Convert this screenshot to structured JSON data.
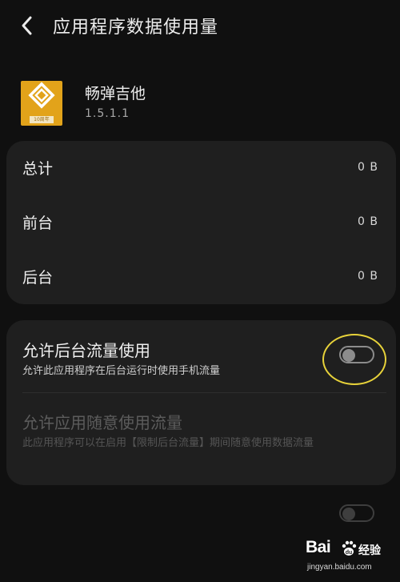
{
  "header": {
    "title": "应用程序数据使用量",
    "back_icon": "chevron-left-icon"
  },
  "app": {
    "name": "畅弹吉他",
    "version": "1.5.1.1",
    "icon": "app-logo-icon",
    "icon_badge": "10周年",
    "icon_color": "#e2a31a"
  },
  "usage": {
    "rows": [
      {
        "label": "总计",
        "value": "0 B"
      },
      {
        "label": "前台",
        "value": "0 B"
      },
      {
        "label": "后台",
        "value": "0 B"
      }
    ]
  },
  "permissions": {
    "background_data": {
      "title": "允许后台流量使用",
      "description": "允许此应用程序在后台运行时使用手机流量",
      "enabled": false
    },
    "unrestricted_data": {
      "title": "允许应用随意使用流量",
      "description": "此应用程序可以在启用【限制后台流量】期间随意使用数据流量",
      "enabled": false,
      "disabled": true
    }
  },
  "watermark": {
    "brand": "Bai",
    "brand_suffix": "经验",
    "url": "jingyan.baidu.com"
  },
  "colors": {
    "background": "#101010",
    "card": "#1f1f1f",
    "highlight_ring": "#e7d23a",
    "app_icon": "#e2a31a"
  }
}
